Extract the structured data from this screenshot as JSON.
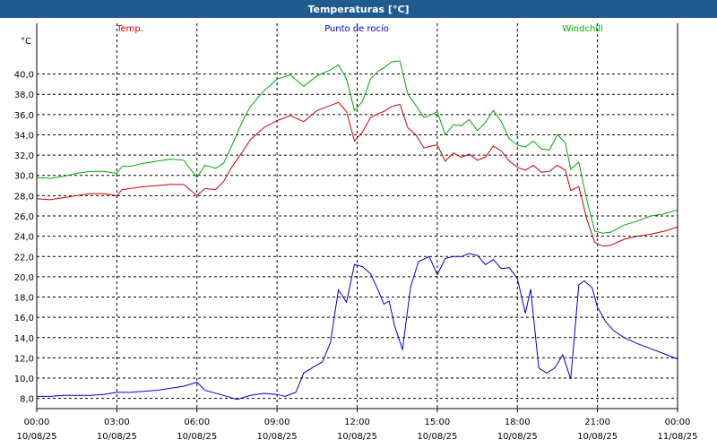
{
  "window": {
    "title": "Temperaturas [°C]"
  },
  "chart_data": {
    "type": "line",
    "title": "Temperaturas [°C]",
    "ylabel": "°C",
    "ylim": [
      7,
      45
    ],
    "yticks": [
      "8,0",
      "10,0",
      "12,0",
      "14,0",
      "16,0",
      "18,0",
      "20,0",
      "22,0",
      "24,0",
      "26,0",
      "28,0",
      "30,0",
      "32,0",
      "34,0",
      "36,0",
      "38,0",
      "40,0"
    ],
    "ytick_values": [
      8,
      10,
      12,
      14,
      16,
      18,
      20,
      22,
      24,
      26,
      28,
      30,
      32,
      34,
      36,
      38,
      40
    ],
    "xlim": [
      0,
      24
    ],
    "xticks": [
      {
        "time": "00:00",
        "date": "10/08/25",
        "hour": 0
      },
      {
        "time": "03:00",
        "date": "10/08/25",
        "hour": 3
      },
      {
        "time": "06:00",
        "date": "10/08/25",
        "hour": 6
      },
      {
        "time": "09:00",
        "date": "10/08/25",
        "hour": 9
      },
      {
        "time": "12:00",
        "date": "10/08/25",
        "hour": 12
      },
      {
        "time": "15:00",
        "date": "10/08/25",
        "hour": 15
      },
      {
        "time": "18:00",
        "date": "10/08/25",
        "hour": 18
      },
      {
        "time": "21:00",
        "date": "10/08/25",
        "hour": 21
      },
      {
        "time": "00:00",
        "date": "11/08/25",
        "hour": 24
      }
    ],
    "grid": true,
    "legend_position": "top",
    "series": [
      {
        "name": "Temp.",
        "color": "#cc0000",
        "x": [
          0,
          0.5,
          1,
          1.5,
          2,
          2.5,
          3,
          3.2,
          3.5,
          4,
          4.5,
          5,
          5.5,
          6,
          6.3,
          6.7,
          7,
          7.3,
          7.7,
          8,
          8.5,
          9,
          9.5,
          10,
          10.5,
          11,
          11.3,
          11.6,
          11.9,
          12.2,
          12.5,
          12.8,
          13,
          13.3,
          13.6,
          13.9,
          14.2,
          14.5,
          14.8,
          15,
          15.3,
          15.6,
          15.9,
          16.2,
          16.5,
          16.8,
          17.1,
          17.4,
          17.7,
          18,
          18.3,
          18.6,
          18.9,
          19.2,
          19.5,
          19.8,
          20,
          20.3,
          20.6,
          20.9,
          21.2,
          21.5,
          22,
          22.5,
          23,
          23.5,
          24
        ],
        "values": [
          27.7,
          27.6,
          27.8,
          28.0,
          28.2,
          28.2,
          28.0,
          28.6,
          28.7,
          28.9,
          29.0,
          29.1,
          29.1,
          28.0,
          28.7,
          28.6,
          29.4,
          30.8,
          32.3,
          33.5,
          34.7,
          35.4,
          35.9,
          35.3,
          36.4,
          36.9,
          37.2,
          36.3,
          33.4,
          34.3,
          35.7,
          36.1,
          36.3,
          36.8,
          37.0,
          34.7,
          34.0,
          32.7,
          32.9,
          33.0,
          31.4,
          32.2,
          31.8,
          32.1,
          31.5,
          31.8,
          32.9,
          32.4,
          31.4,
          30.8,
          30.5,
          31.0,
          30.3,
          30.4,
          31.0,
          30.5,
          28.5,
          28.9,
          25.7,
          23.4,
          23.0,
          23.1,
          23.7,
          24.0,
          24.2,
          24.5,
          24.9
        ]
      },
      {
        "name": "Punto de rocío",
        "color": "#0000cc",
        "x": [
          0,
          0.5,
          1,
          1.5,
          2,
          2.5,
          3,
          3.5,
          4,
          4.5,
          5,
          5.5,
          6,
          6.3,
          7,
          7.5,
          8,
          8.5,
          9,
          9.3,
          9.7,
          10,
          10.3,
          10.7,
          11,
          11.3,
          11.6,
          11.9,
          12.2,
          12.5,
          12.8,
          13,
          13.2,
          13.4,
          13.7,
          14,
          14.3,
          14.7,
          15,
          15.3,
          15.6,
          15.9,
          16.2,
          16.5,
          16.8,
          17.1,
          17.4,
          17.7,
          18,
          18.3,
          18.5,
          18.8,
          19.1,
          19.4,
          19.7,
          20,
          20.3,
          20.5,
          20.8,
          21,
          21.3,
          21.6,
          22,
          22.5,
          23,
          23.5,
          24
        ],
        "values": [
          8.2,
          8.2,
          8.3,
          8.3,
          8.3,
          8.4,
          8.6,
          8.6,
          8.7,
          8.8,
          9.0,
          9.2,
          9.6,
          8.8,
          8.3,
          7.9,
          8.3,
          8.5,
          8.4,
          8.2,
          8.6,
          10.5,
          11.0,
          11.6,
          13.5,
          18.7,
          17.5,
          21.2,
          21.0,
          20.3,
          18.6,
          17.3,
          17.6,
          15.2,
          12.8,
          19.0,
          21.5,
          22.0,
          20.2,
          21.8,
          22.0,
          22.0,
          22.3,
          22.1,
          21.2,
          21.7,
          20.8,
          20.9,
          19.8,
          16.4,
          18.8,
          11.0,
          10.5,
          11.0,
          12.3,
          9.9,
          19.2,
          19.6,
          18.9,
          17.0,
          15.6,
          14.7,
          14.0,
          13.4,
          12.9,
          12.4,
          11.9
        ]
      },
      {
        "name": "Windchill",
        "color": "#00aa00",
        "x": [
          0,
          0.5,
          1,
          1.5,
          2,
          2.5,
          3,
          3.2,
          3.5,
          4,
          4.5,
          5,
          5.5,
          6,
          6.3,
          6.7,
          7,
          7.3,
          7.7,
          8,
          8.5,
          9,
          9.5,
          10,
          10.5,
          11,
          11.3,
          11.6,
          11.9,
          12.2,
          12.5,
          12.8,
          13,
          13.3,
          13.6,
          13.9,
          14.2,
          14.5,
          14.8,
          15,
          15.3,
          15.6,
          15.9,
          16.2,
          16.5,
          16.8,
          17.1,
          17.4,
          17.7,
          18,
          18.3,
          18.6,
          18.9,
          19.2,
          19.5,
          19.8,
          20,
          20.3,
          20.6,
          20.9,
          21.2,
          21.5,
          22,
          22.5,
          23,
          23.5,
          24
        ],
        "values": [
          29.8,
          29.7,
          29.9,
          30.2,
          30.4,
          30.4,
          30.2,
          30.9,
          30.9,
          31.2,
          31.4,
          31.6,
          31.5,
          29.8,
          31.0,
          30.7,
          31.2,
          32.9,
          35.3,
          36.8,
          38.3,
          39.5,
          39.9,
          38.8,
          39.8,
          40.4,
          40.9,
          39.5,
          36.4,
          37.3,
          39.5,
          40.3,
          40.6,
          41.2,
          41.3,
          38.0,
          36.9,
          35.7,
          36.0,
          36.3,
          34.0,
          35.0,
          34.9,
          35.5,
          34.4,
          35.2,
          36.4,
          35.3,
          33.6,
          33.0,
          32.8,
          33.4,
          32.6,
          32.5,
          34.0,
          33.2,
          30.6,
          31.3,
          27.6,
          24.5,
          24.3,
          24.4,
          25.1,
          25.5,
          26.0,
          26.2,
          26.6
        ]
      }
    ]
  }
}
